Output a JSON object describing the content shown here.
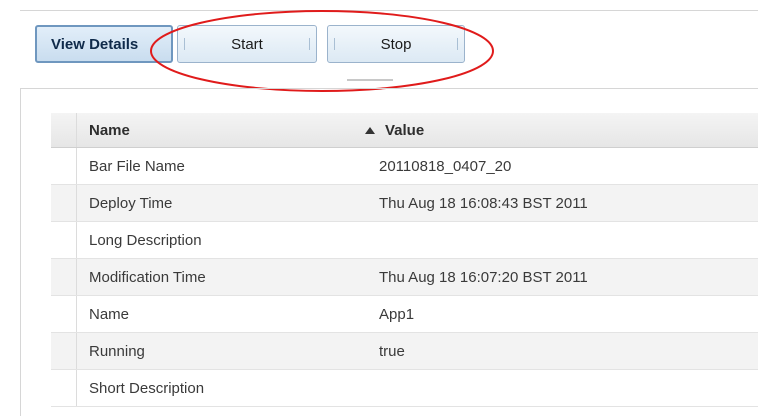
{
  "toolbar": {
    "view_details_label": "View Details",
    "start_label": "Start",
    "stop_label": "Stop"
  },
  "annotation": {
    "ring_color": "#e01b1b"
  },
  "properties": {
    "columns": {
      "name": "Name",
      "value": "Value",
      "sort_column": "value",
      "sort_direction": "ascending",
      "sort_icon": "sort-ascending-icon"
    },
    "rows": [
      {
        "name": "Bar File Name",
        "value": "20110818_0407_20"
      },
      {
        "name": "Deploy Time",
        "value": "Thu Aug 18 16:08:43 BST 2011"
      },
      {
        "name": "Long Description",
        "value": ""
      },
      {
        "name": "Modification Time",
        "value": "Thu Aug 18 16:07:20 BST 2011"
      },
      {
        "name": "Name",
        "value": "App1"
      },
      {
        "name": "Running",
        "value": "true"
      },
      {
        "name": "Short Description",
        "value": ""
      }
    ]
  }
}
